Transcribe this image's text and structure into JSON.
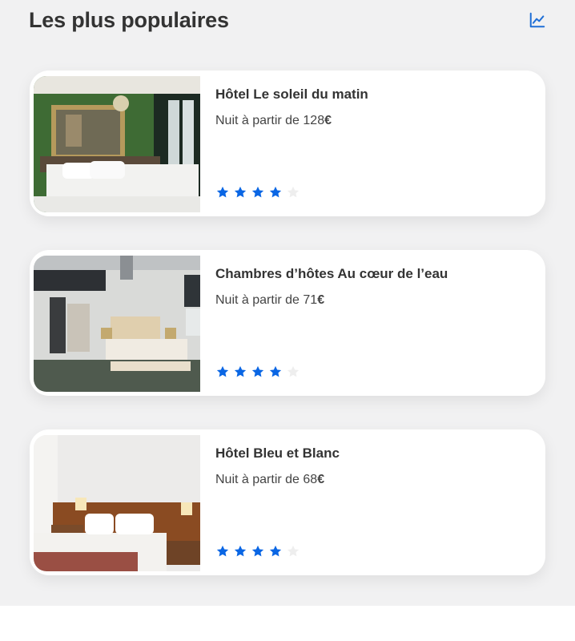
{
  "header": {
    "title": "Les plus populaires",
    "trend_icon": "trending-chart-icon"
  },
  "colors": {
    "accent": "#1f6fd6",
    "star_filled": "#0a66e4",
    "star_empty": "#eeeeee",
    "background": "#f1f1f2"
  },
  "hotels": [
    {
      "name": "Hôtel Le soleil du matin",
      "price_prefix": "Nuit à partir de ",
      "price": "128",
      "currency": "€",
      "rating": 4,
      "max_rating": 5
    },
    {
      "name": "Chambres d’hôtes Au cœur de l’eau",
      "price_prefix": "Nuit à partir de ",
      "price": "71",
      "currency": "€",
      "rating": 4,
      "max_rating": 5
    },
    {
      "name": "Hôtel Bleu et Blanc",
      "price_prefix": "Nuit à partir de ",
      "price": "68",
      "currency": "€",
      "rating": 4,
      "max_rating": 5
    }
  ]
}
